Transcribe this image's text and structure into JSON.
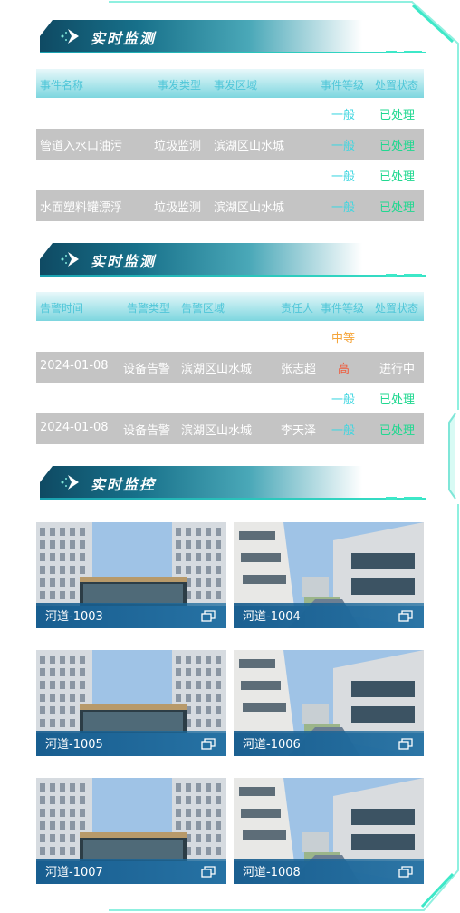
{
  "monitor1": {
    "title": "实时监测",
    "headers": [
      "事件名称",
      "事发类型",
      "事发区域",
      "事件等级",
      "处置状态"
    ],
    "rows": [
      {
        "name": "",
        "type": "",
        "area": "",
        "level": "一般",
        "level_kind": "normal",
        "status": "已处理",
        "status_kind": "done"
      },
      {
        "name": "管道入水口油污",
        "type": "垃圾监测",
        "area": "滨湖区山水城",
        "level": "一般",
        "level_kind": "normal",
        "status": "已处理",
        "status_kind": "done"
      },
      {
        "name": "",
        "type": "",
        "area": "",
        "level": "一般",
        "level_kind": "normal",
        "status": "已处理",
        "status_kind": "done"
      },
      {
        "name": "水面塑料罐漂浮",
        "type": "垃圾监测",
        "area": "滨湖区山水城",
        "level": "一般",
        "level_kind": "normal",
        "status": "已处理",
        "status_kind": "done"
      }
    ]
  },
  "monitor2": {
    "title": "实时监测",
    "headers": [
      "告警时间",
      "告警类型",
      "告警区域",
      "责任人",
      "事件等级",
      "处置状态"
    ],
    "rows": [
      {
        "time": "",
        "type": "",
        "area": "",
        "person": "",
        "level": "中等",
        "level_kind": "mid",
        "status": "",
        "status_kind": "done"
      },
      {
        "time": "2024-01-08",
        "type": "设备告警",
        "area": "滨湖区山水城",
        "person": "张志超",
        "level": "高",
        "level_kind": "high",
        "status": "进行中",
        "status_kind": "doing"
      },
      {
        "time": "",
        "type": "",
        "area": "",
        "person": "",
        "level": "一般",
        "level_kind": "normal",
        "status": "已处理",
        "status_kind": "done"
      },
      {
        "time": "2024-01-08",
        "type": "设备告警",
        "area": "滨湖区山水城",
        "person": "李天泽",
        "level": "一般",
        "level_kind": "normal",
        "status": "已处理",
        "status_kind": "done"
      }
    ]
  },
  "videos": {
    "title": "实时监控",
    "items": [
      {
        "label": "河道-1003",
        "scene": "building-a"
      },
      {
        "label": "河道-1004",
        "scene": "building-b"
      },
      {
        "label": "河道-1005",
        "scene": "building-a"
      },
      {
        "label": "河道-1006",
        "scene": "building-b"
      },
      {
        "label": "河道-1007",
        "scene": "building-a"
      },
      {
        "label": "河道-1008",
        "scene": "building-b"
      }
    ]
  },
  "colors": {
    "accent": "#3de8c8",
    "header_plate": "#17708a",
    "level_normal": "#3fd6e0",
    "level_mid": "#f5a53a",
    "level_high": "#f05a3a",
    "status_done": "#20d890"
  }
}
